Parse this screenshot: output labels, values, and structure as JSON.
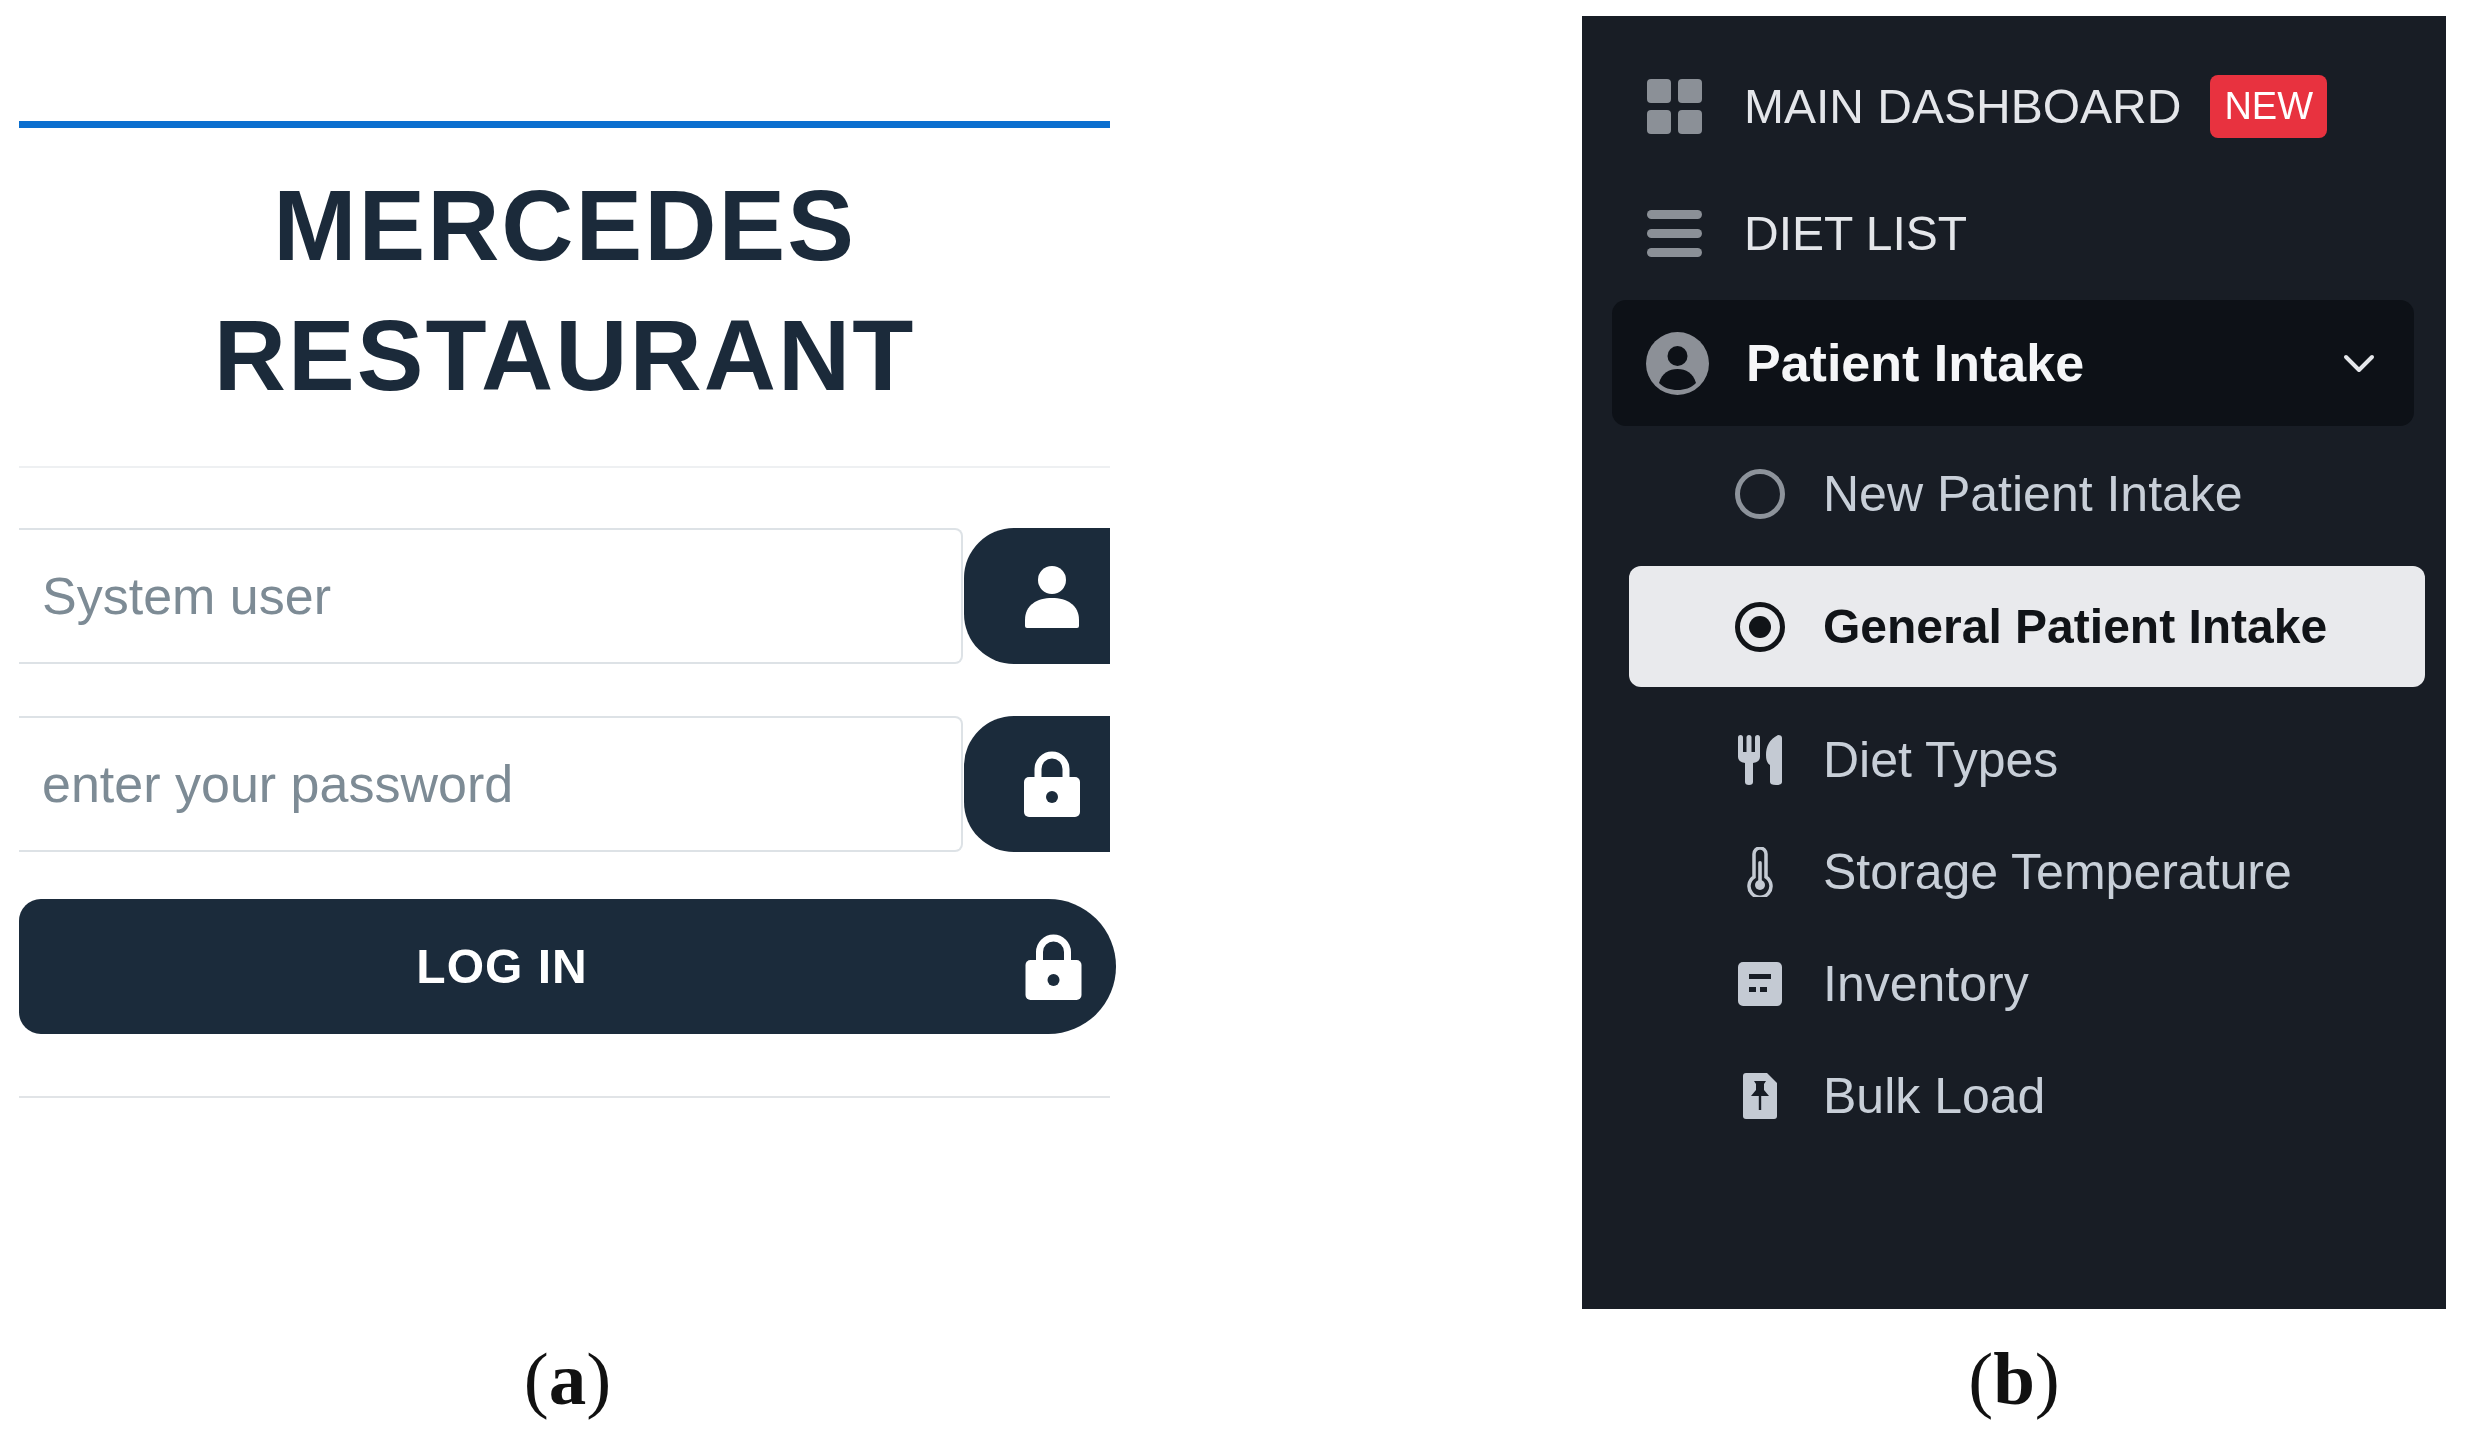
{
  "login": {
    "title": "MERCEDES RESTAURANT",
    "fields": [
      {
        "kind": "text",
        "placeholder": "System user"
      },
      {
        "kind": "password",
        "placeholder": "enter your password"
      }
    ],
    "submit": "LOG IN",
    "caption": "(**a**)"
  },
  "sidebar": {
    "items": [
      {
        "kind": "link",
        "label": "MAIN DASHBOARD",
        "badge": "NEW"
      },
      {
        "kind": "link",
        "label": "DIET LIST"
      },
      {
        "kind": "group",
        "label": "Patient Intake",
        "expanded": true,
        "children": [
          {
            "kind": "radio",
            "label": "New Patient Intake",
            "selected": false
          },
          {
            "kind": "radio",
            "label": "General Patient Intake",
            "selected": true
          },
          {
            "kind": "link",
            "label": "Diet Types",
            "selected": false
          },
          {
            "kind": "link",
            "label": "Storage Temperature",
            "selected": false
          },
          {
            "kind": "link",
            "label": "Inventory",
            "selected": false
          },
          {
            "kind": "link",
            "label": "Bulk Load",
            "selected": false
          }
        ]
      }
    ],
    "caption": "(**b**)"
  }
}
